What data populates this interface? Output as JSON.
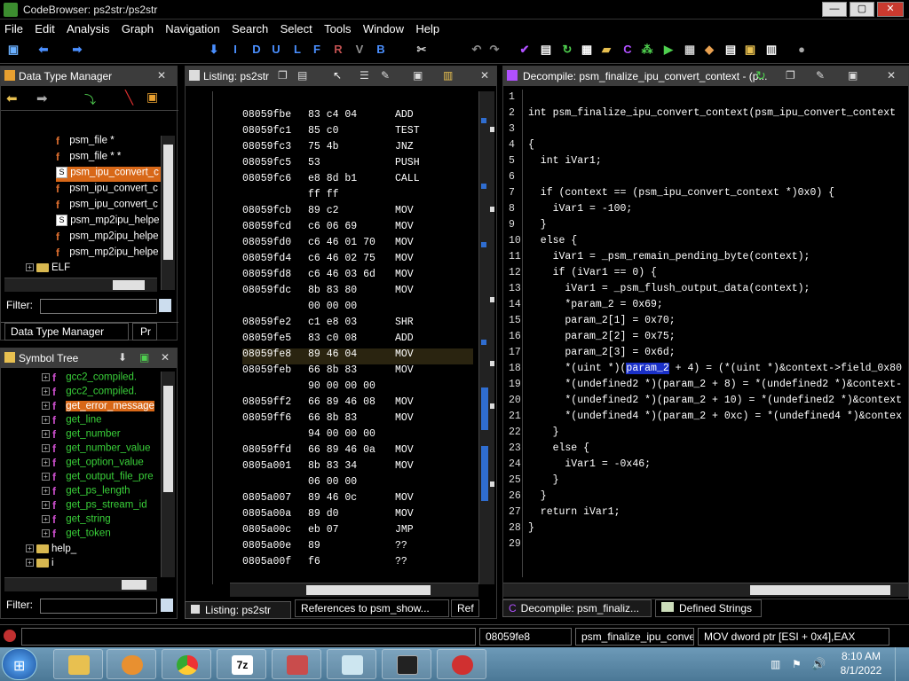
{
  "window": {
    "title": "CodeBrowser: ps2str:/ps2str",
    "min": "—",
    "max": "▢",
    "close": "✕"
  },
  "menu": [
    "File",
    "Edit",
    "Analysis",
    "Graph",
    "Navigation",
    "Search",
    "Select",
    "Tools",
    "Window",
    "Help"
  ],
  "dtm": {
    "title": "Data Type Manager",
    "items": [
      {
        "label": "psm_file *",
        "icon": "function-icon"
      },
      {
        "label": "psm_file * *",
        "icon": "function-icon"
      },
      {
        "label": "psm_ipu_convert_c",
        "icon": "struct-icon"
      },
      {
        "label": "psm_ipu_convert_c",
        "icon": "function-icon"
      },
      {
        "label": "psm_ipu_convert_c",
        "icon": "function-icon"
      },
      {
        "label": "psm_mp2ipu_helpe",
        "icon": "struct-icon"
      },
      {
        "label": "psm_mp2ipu_helpe",
        "icon": "function-icon"
      },
      {
        "label": "psm_mp2ipu_helpe",
        "icon": "function-icon"
      }
    ],
    "folder": "ELF",
    "filter_label": "Filter:",
    "tab1": "Data Type Manager",
    "tab2": "Pr"
  },
  "symtree": {
    "title": "Symbol Tree",
    "items": [
      "gcc2_compiled.",
      "gcc2_compiled.",
      "get_error_message",
      "get_line",
      "get_number",
      "get_number_value",
      "get_option_value",
      "get_output_file_pre",
      "get_ps_length",
      "get_ps_stream_id",
      "get_string",
      "get_token"
    ],
    "folders": [
      "help_",
      "i"
    ],
    "filter_label": "Filter:"
  },
  "listing": {
    "title": "Listing:  ps2str",
    "rows": [
      {
        "addr": "",
        "bytes": "ff ff",
        "mn": ""
      },
      {
        "addr": "08059fbe",
        "bytes": "83 c4 04",
        "mn": "ADD"
      },
      {
        "addr": "08059fc1",
        "bytes": "85 c0",
        "mn": "TEST"
      },
      {
        "addr": "08059fc3",
        "bytes": "75 4b",
        "mn": "JNZ"
      },
      {
        "addr": "08059fc5",
        "bytes": "53",
        "mn": "PUSH"
      },
      {
        "addr": "08059fc6",
        "bytes": "e8 8d b1",
        "mn": "CALL"
      },
      {
        "addr": "",
        "bytes": "ff ff",
        "mn": ""
      },
      {
        "addr": "08059fcb",
        "bytes": "89 c2",
        "mn": "MOV"
      },
      {
        "addr": "08059fcd",
        "bytes": "c6 06 69",
        "mn": "MOV"
      },
      {
        "addr": "08059fd0",
        "bytes": "c6 46 01 70",
        "mn": "MOV"
      },
      {
        "addr": "08059fd4",
        "bytes": "c6 46 02 75",
        "mn": "MOV"
      },
      {
        "addr": "08059fd8",
        "bytes": "c6 46 03 6d",
        "mn": "MOV"
      },
      {
        "addr": "08059fdc",
        "bytes": "8b 83 80",
        "mn": "MOV"
      },
      {
        "addr": "",
        "bytes": "00 00 00",
        "mn": ""
      },
      {
        "addr": "08059fe2",
        "bytes": "c1 e8 03",
        "mn": "SHR"
      },
      {
        "addr": "08059fe5",
        "bytes": "83 c0 08",
        "mn": "ADD"
      },
      {
        "addr": "08059fe8",
        "bytes": "89 46 04",
        "mn": "MOV"
      },
      {
        "addr": "08059feb",
        "bytes": "66 8b 83",
        "mn": "MOV"
      },
      {
        "addr": "",
        "bytes": "90 00 00 00",
        "mn": ""
      },
      {
        "addr": "08059ff2",
        "bytes": "66 89 46 08",
        "mn": "MOV"
      },
      {
        "addr": "08059ff6",
        "bytes": "66 8b 83",
        "mn": "MOV"
      },
      {
        "addr": "",
        "bytes": "94 00 00 00",
        "mn": ""
      },
      {
        "addr": "08059ffd",
        "bytes": "66 89 46 0a",
        "mn": "MOV"
      },
      {
        "addr": "0805a001",
        "bytes": "8b 83 34",
        "mn": "MOV"
      },
      {
        "addr": "",
        "bytes": "06 00 00",
        "mn": ""
      },
      {
        "addr": "0805a007",
        "bytes": "89 46 0c",
        "mn": "MOV"
      },
      {
        "addr": "0805a00a",
        "bytes": "89 d0",
        "mn": "MOV"
      },
      {
        "addr": "0805a00c",
        "bytes": "eb 07",
        "mn": "JMP"
      },
      {
        "addr": "0805a00e",
        "bytes": "89",
        "mn": "??"
      },
      {
        "addr": "0805a00f",
        "bytes": "f6",
        "mn": "??"
      }
    ],
    "cut_row": "LAB_0805a010"
  },
  "decompile": {
    "title": "Decompile: psm_finalize_ipu_convert_context - (p...",
    "lines": [
      "",
      "int psm_finalize_ipu_convert_context(psm_ipu_convert_context",
      "",
      "{",
      "  int iVar1;",
      "",
      "  if (context == (psm_ipu_convert_context *)0x0) {",
      "    iVar1 = -100;",
      "  }",
      "  else {",
      "    iVar1 = _psm_remain_pending_byte(context);",
      "    if (iVar1 == 0) {",
      "      iVar1 = _psm_flush_output_data(context);",
      "      *param_2 = 0x69;",
      "      param_2[1] = 0x70;",
      "      param_2[2] = 0x75;",
      "      param_2[3] = 0x6d;",
      "      *(uint *)(param_2 + 4) = (*(uint *)&context->field_0x80",
      "      *(undefined2 *)(param_2 + 8) = *(undefined2 *)&context-",
      "      *(undefined2 *)(param_2 + 10) = *(undefined2 *)&context",
      "      *(undefined4 *)(param_2 + 0xc) = *(undefined4 *)&contex",
      "    }",
      "    else {",
      "      iVar1 = -0x46;",
      "    }",
      "  }",
      "  return iVar1;",
      "}",
      ""
    ],
    "highlight": "param_2"
  },
  "bottom_tabs": {
    "listing": "Listing:  ps2str",
    "refs": "References to psm_show...",
    "ref": "Ref",
    "decomp": "Decompile: psm_finaliz...",
    "strings": "Defined Strings"
  },
  "status": {
    "addr": "08059fe8",
    "func": "psm_finalize_ipu_conve...",
    "instr": "MOV dword ptr [ESI + 0x4],EAX"
  },
  "taskbar": {
    "time": "8:10 AM",
    "date": "8/1/2022",
    "apps": [
      "explorer",
      "media-player",
      "chrome",
      "7zip",
      "ghidra-tool",
      "notepad",
      "terminal",
      "ghidra"
    ]
  },
  "colors": {
    "selected_item": "#e07020",
    "symbol_green": "#3ad23a",
    "highlight": "#1a30c8",
    "accent_blue": "#2f6dd0"
  }
}
